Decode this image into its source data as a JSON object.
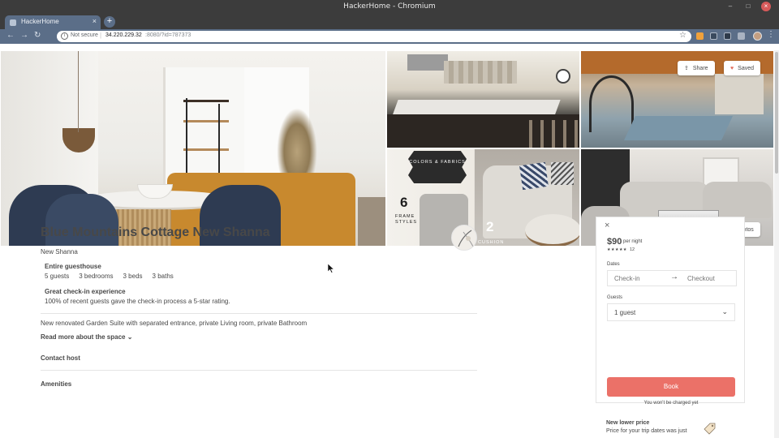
{
  "browser": {
    "window_title": "HackerHome - Chromium",
    "tab_title": "HackerHome",
    "tab_close": "×",
    "new_tab": "+",
    "not_secure": "Not secure",
    "url_host": "34.220.229.32",
    "url_path": ":8080/?id=787373"
  },
  "photos": {
    "share_label": "Share",
    "saved_label": "Saved",
    "view_photos_label": "View Photos",
    "fabric_badge": "COLORS & FABRICS",
    "frame_number": "6",
    "frame_label": "FRAME STYLES",
    "cushion_number": "2",
    "cushion_label": "CUSHION"
  },
  "listing": {
    "title": "Blue Mountains Cottage New Shanna",
    "location": "New Shanna",
    "highlights": [
      {
        "title": "Entire guesthouse",
        "details": [
          "5 guests",
          "3 bedrooms",
          "3 beds",
          "3 baths"
        ]
      },
      {
        "title": "Great check-in experience",
        "text": "100% of recent guests gave the check-in process a 5-star rating."
      }
    ],
    "description": "New renovated Garden Suite with separated entrance, private Living room, private Bathroom",
    "read_more": "Read more about the space",
    "contact_host": "Contact host",
    "amenities": "Amenities"
  },
  "booking": {
    "close": "×",
    "price": "$90",
    "per_night": "per night",
    "stars": "★★★★★",
    "review_count": "12",
    "dates_label": "Dates",
    "checkin_placeholder": "Check-in",
    "arrow": "→",
    "checkout_placeholder": "Checkout",
    "guests_label": "Guests",
    "guests_value": "1 guest",
    "book_label": "Book",
    "no_charge": "You won't be charged yet",
    "lower_price_title": "New lower price",
    "lower_price_text": "Price for your trip dates was just"
  },
  "colors": {
    "book_button": "#eb7168",
    "saved_heart": "#e26d5c",
    "tab_active": "#5b6e88"
  }
}
